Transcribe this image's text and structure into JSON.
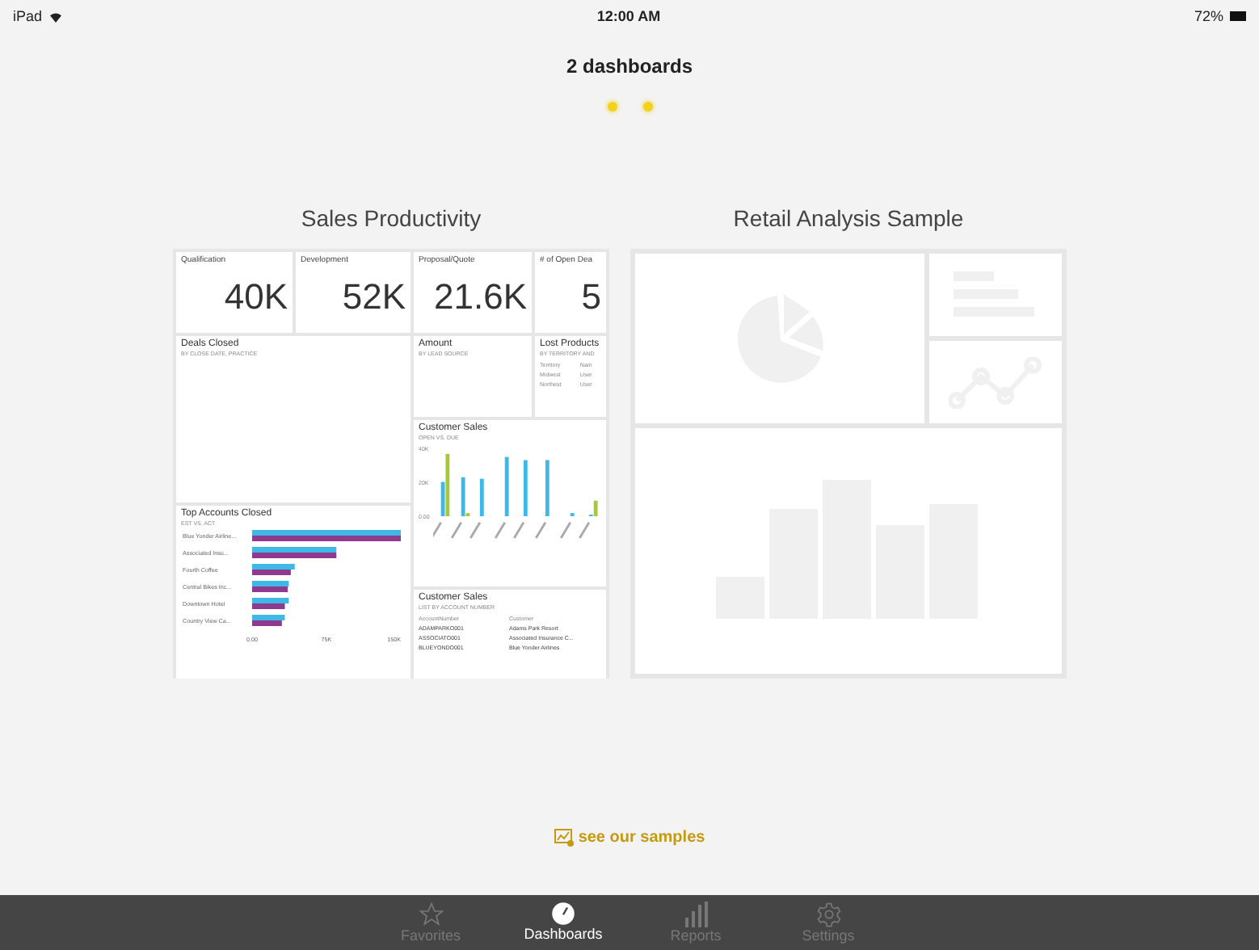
{
  "status_bar": {
    "device": "iPad",
    "time": "12:00 AM",
    "battery": "72%"
  },
  "title": "2 dashboards",
  "dashboards": [
    {
      "kind": "preview",
      "title": "Sales Productivity",
      "kpis": [
        {
          "label": "Qualification",
          "value": "40K"
        },
        {
          "label": "Development",
          "value": "52K"
        },
        {
          "label": "Proposal/Quote",
          "value": "21.6K"
        },
        {
          "label": "# of Open Dea",
          "value": "5"
        }
      ],
      "deals_closed": {
        "title": "Deals Closed",
        "subtitle": "BY CLOSE DATE, PRACTICE"
      },
      "amount": {
        "title": "Amount",
        "subtitle": "BY LEAD SOURCE"
      },
      "lost_products": {
        "title": "Lost Products",
        "subtitle": "BY TERRITORY AND",
        "rows": [
          [
            "Territory",
            "Nam"
          ],
          [
            "Midwest",
            "User"
          ],
          [
            "Northest",
            "User"
          ]
        ]
      },
      "customer_chart": {
        "title": "Customer Sales",
        "subtitle": "OPEN VS. DUE",
        "yticks": [
          "40K",
          "20K",
          "0.00"
        ]
      },
      "top_accounts": {
        "title": "Top Accounts Closed",
        "subtitle": "EST VS. ACT",
        "chart_data": {
          "type": "bar",
          "orientation": "horizontal",
          "categories": [
            "Blue Yonder Airline...",
            "Associated Insu...",
            "Fourth Coffee",
            "Central Bikes Inc...",
            "Downtown Hotel",
            "Country View Ca..."
          ],
          "series": [
            {
              "color": "#3fb8e6",
              "values": [
                150000,
                85000,
                43000,
                37000,
                37000,
                33000
              ]
            },
            {
              "color": "#8e3a8e",
              "values": [
                150000,
                85000,
                39000,
                36000,
                33000,
                30000
              ]
            }
          ],
          "xlim": [
            0,
            150000
          ],
          "xticks": [
            {
              "value": 0,
              "label": "0.00"
            },
            {
              "value": 75000,
              "label": "75K"
            },
            {
              "value": 150000,
              "label": "150K"
            }
          ]
        }
      },
      "customer_table": {
        "title": "Customer Sales",
        "subtitle": "LIST BY ACCOUNT NUMBER",
        "columns": [
          "AccountNumber",
          "Customer"
        ],
        "rows": [
          [
            "ADAMPARKO001",
            "Adams Park Resort"
          ],
          [
            "ASSOCIATO001",
            "Associated Insurance C..."
          ],
          [
            "BLUEYONDO001",
            "Blue Yonder Airlines"
          ]
        ]
      }
    },
    {
      "kind": "placeholder",
      "title": "Retail Analysis Sample"
    }
  ],
  "samples_link": "see our samples",
  "tabs": [
    {
      "label": "Favorites",
      "selected": false
    },
    {
      "label": "Dashboards",
      "selected": true
    },
    {
      "label": "Reports",
      "selected": false
    },
    {
      "label": "Settings",
      "selected": false
    }
  ]
}
